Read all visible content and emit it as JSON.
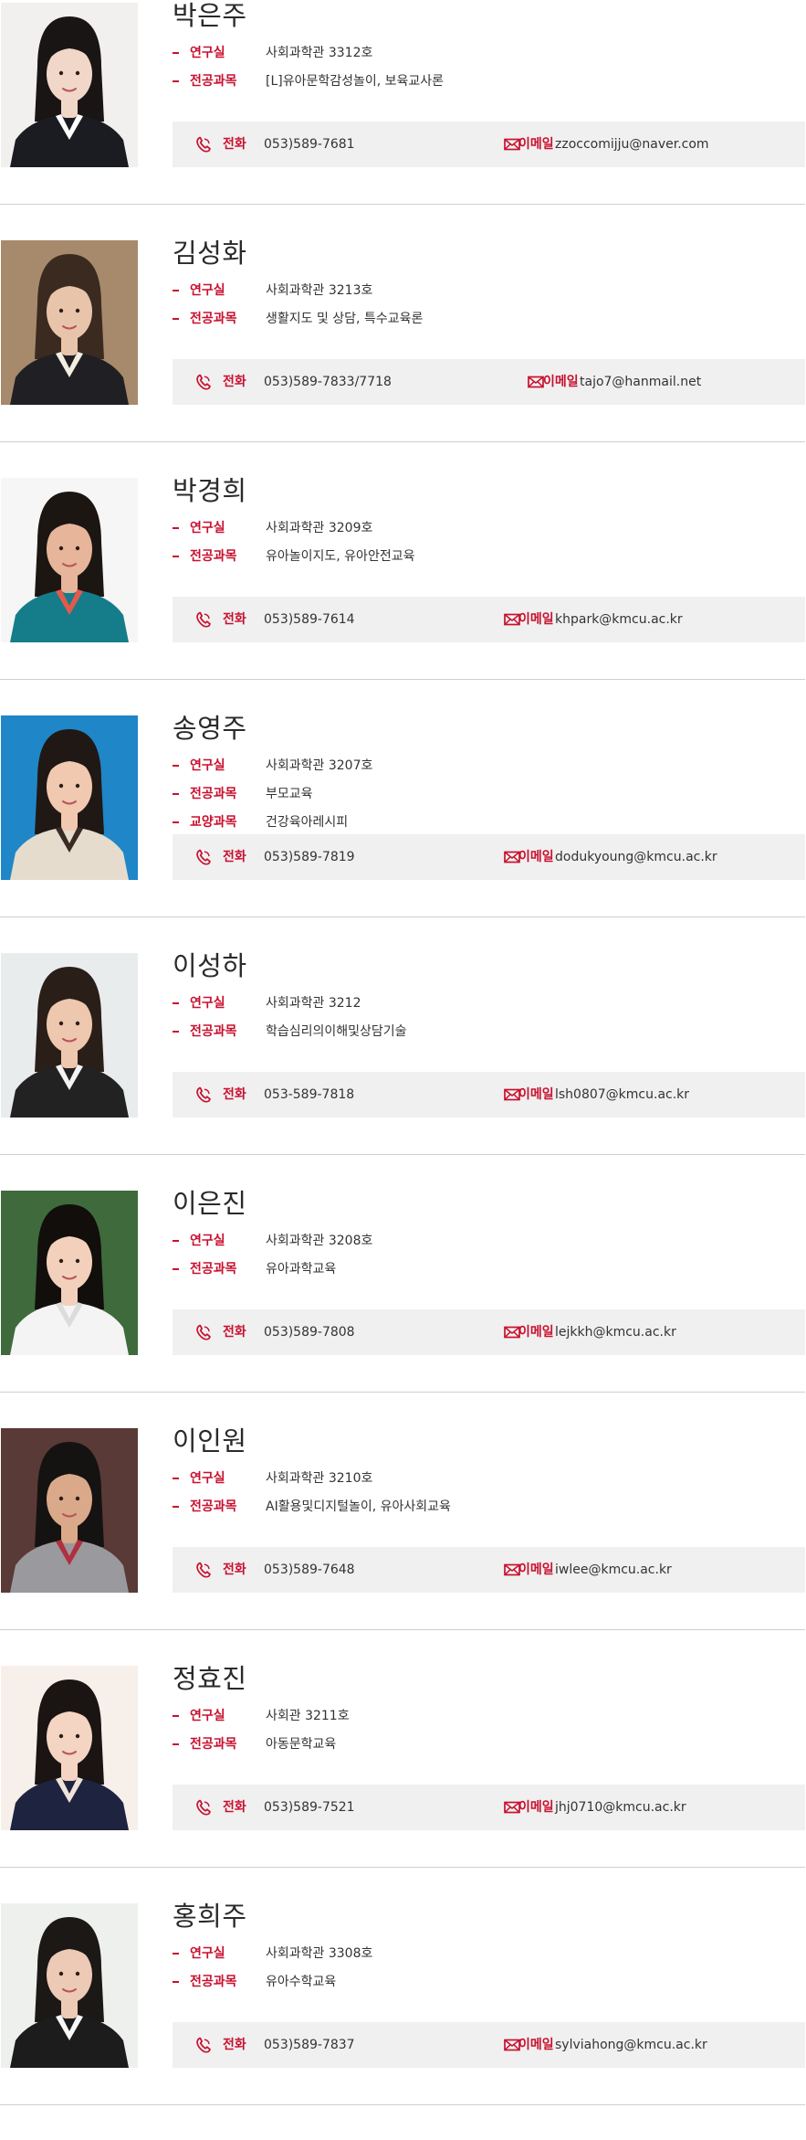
{
  "labels": {
    "office": "연구실",
    "major": "전공과목",
    "liberal": "교양과목",
    "phone": "전화",
    "email": "이메일"
  },
  "professors": [
    {
      "name": "박은주",
      "office": "사회과학관 3312호",
      "major": "[L]유아문학감성놀이, 보육교사론",
      "phone": "053)589-7681",
      "email": "zzoccomijju@naver.com",
      "photo": {
        "bg": "#f2f0ee",
        "hair": "#1a1515",
        "skin": "#f1d7c8",
        "shirt": "#1b1b22",
        "accent": "#ffffff"
      }
    },
    {
      "name": "김성화",
      "office": "사회과학관 3213호",
      "major": "생활지도 및 상담, 특수교육론",
      "phone": "053)589-7833/7718",
      "email": "tajo7@hanmail.net",
      "photo": {
        "bg": "#a68a6b",
        "hair": "#3b2a20",
        "skin": "#e8c4aa",
        "shirt": "#202024",
        "accent": "#f3ede2"
      }
    },
    {
      "name": "박경희",
      "office": "사회과학관 3209호",
      "major": "유아놀이지도, 유아안전교육",
      "phone": "053)589-7614",
      "email": "khpark@kmcu.ac.kr",
      "photo": {
        "bg": "#f6f6f6",
        "hair": "#1c1612",
        "skin": "#e7b59a",
        "shirt": "#157d8a",
        "accent": "#e35a4c"
      }
    },
    {
      "name": "송영주",
      "office": "사회과학관 3207호",
      "major": "부모교육",
      "liberal": "건강육아레시피",
      "phone": "053)589-7819",
      "email": "dodukyoung@kmcu.ac.kr",
      "photo": {
        "bg": "#1f86c8",
        "hair": "#201814",
        "skin": "#f0c9b0",
        "shirt": "#e6dccd",
        "accent": "#3a2a24"
      }
    },
    {
      "name": "이성하",
      "office": "사회과학관 3212",
      "major": "학습심리의이해및상담기술",
      "phone": "053-589-7818",
      "email": "lsh0807@kmcu.ac.kr",
      "photo": {
        "bg": "#e9ecec",
        "hair": "#2a1e18",
        "skin": "#edc7ae",
        "shirt": "#222222",
        "accent": "#f4f4f4"
      }
    },
    {
      "name": "이은진",
      "office": "사회과학관 3208호",
      "major": "유아과학교육",
      "phone": "053)589-7808",
      "email": "lejkkh@kmcu.ac.kr",
      "photo": {
        "bg": "#3f6a3c",
        "hair": "#120e0c",
        "skin": "#f3d0bc",
        "shirt": "#f4f4f4",
        "accent": "#dcdcdc"
      }
    },
    {
      "name": "이인원",
      "office": "사회과학관 3210호",
      "major": "AI활용및디지털놀이, 유아사회교육",
      "phone": "053)589-7648",
      "email": "iwlee@kmcu.ac.kr",
      "photo": {
        "bg": "#5a3a36",
        "hair": "#151212",
        "skin": "#d9a98a",
        "shirt": "#9a9a9e",
        "accent": "#b03040"
      }
    },
    {
      "name": "정효진",
      "office": "사회관 3211호",
      "major": "아동문학교육",
      "phone": "053)589-7521",
      "email": "jhj0710@kmcu.ac.kr",
      "photo": {
        "bg": "#f7efe9",
        "hair": "#1a1412",
        "skin": "#f4d4c2",
        "shirt": "#1e2340",
        "accent": "#f0e4da"
      }
    },
    {
      "name": "홍희주",
      "office": "사회과학관 3308호",
      "major": "유아수학교육",
      "phone": "053)589-7837",
      "email": "sylviahong@kmcu.ac.kr",
      "photo": {
        "bg": "#eef0ee",
        "hair": "#1b1816",
        "skin": "#eccab6",
        "shirt": "#1c1c1c",
        "accent": "#f8f8f8"
      }
    }
  ]
}
